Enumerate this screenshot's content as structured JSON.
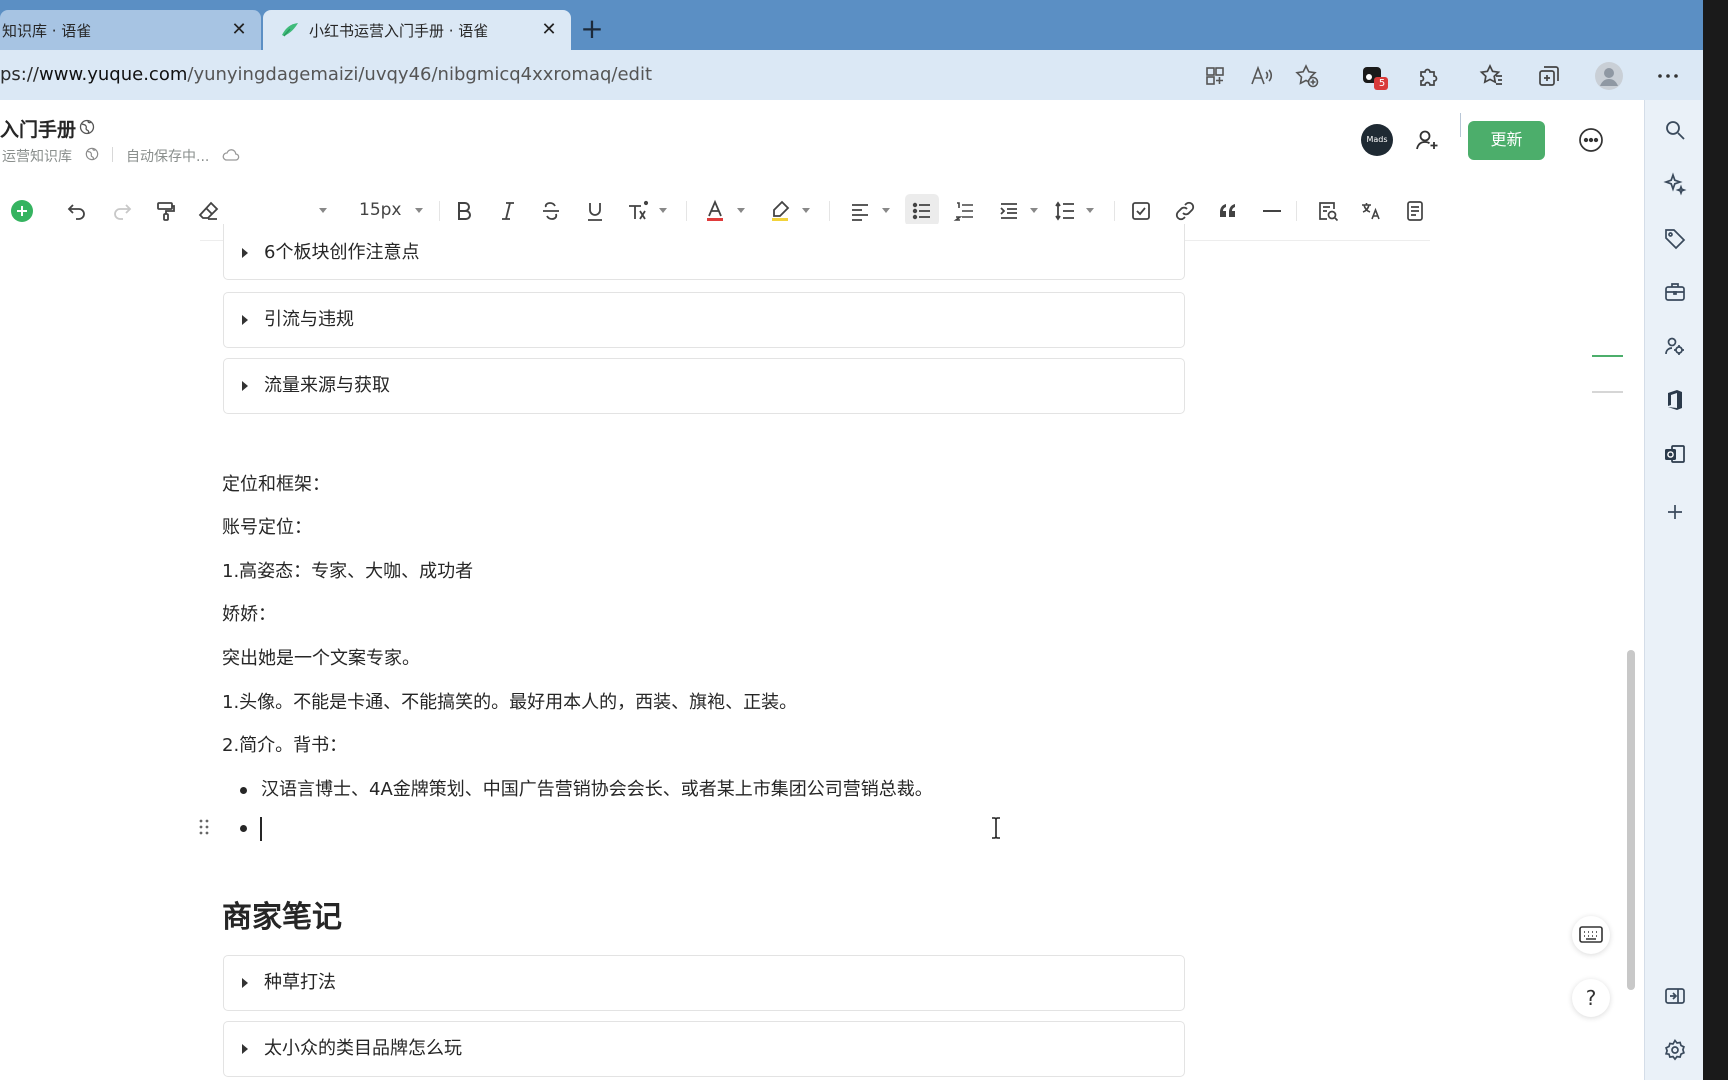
{
  "browser": {
    "tabs": [
      {
        "label": "知识库 · 语雀",
        "active": false
      },
      {
        "label": "小红书运营入门手册 · 语雀",
        "active": true
      }
    ],
    "new_tab": "+",
    "url_prefix": "ps://",
    "url_domain": "www.yuque.com",
    "url_path": "/yunyingdagemaizi/uvqy46/nibgmicq4xxromaq/edit",
    "notification_count": "5"
  },
  "header": {
    "doc_title": "入门手册",
    "knowledge_base": "运营知识库",
    "save_status": "自动保存中...",
    "avatar_text": "Mads",
    "update_label": "更新"
  },
  "toolbar": {
    "font_size": "15px"
  },
  "document": {
    "collapses_top": [
      "6个板块创作注意点",
      "引流与违规",
      "流量来源与获取"
    ],
    "paragraphs": [
      "定位和框架：",
      "账号定位：",
      "1.高姿态：专家、大咖、成功者",
      "娇娇：",
      "突出她是一个文案专家。",
      "1.头像。不能是卡通、不能搞笑的。最好用本人的，西装、旗袍、正装。",
      "2.简介。背书："
    ],
    "bullets": [
      "汉语言博士、4A金牌策划、中国广告营销协会会长、或者某上市集团公司营销总裁。",
      ""
    ],
    "heading": "商家笔记",
    "collapses_bottom": [
      "种草打法",
      "太小众的类目品牌怎么玩"
    ]
  },
  "help_label": "?",
  "colors": {
    "accent": "#4cae6b",
    "tabbar": "#5b8fc4",
    "addressbar": "#dbe8f5",
    "text": "#262626"
  }
}
